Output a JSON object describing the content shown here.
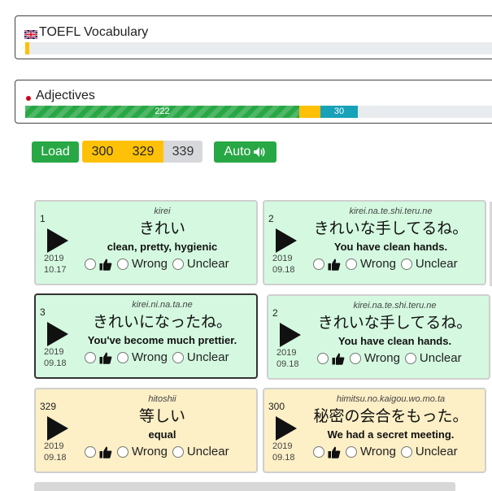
{
  "decks": [
    {
      "title": "TOEFL Vocabulary",
      "flag": "uk-flag",
      "progress": {
        "known_fraction": 0.01
      }
    },
    {
      "title": "Adjectives",
      "flag": "japan-flag",
      "progress": {
        "known": "222",
        "learning": "",
        "review": "30"
      }
    }
  ],
  "toolbar": {
    "load_label": "Load",
    "range_from": "300",
    "range_to": "329",
    "range_total": "339",
    "auto_label": "Auto"
  },
  "options": {
    "wrong": "Wrong",
    "unclear": "Unclear"
  },
  "cards": [
    {
      "num": "1",
      "romaji": "kirei",
      "jp": "きれい",
      "en": "clean, pretty, hygienic",
      "year": "2019",
      "date": "10.17"
    },
    {
      "num": "2",
      "romaji": "kirei.na.te.shi.teru.ne",
      "jp": "きれいな手してるね。",
      "en": "You have clean hands.",
      "year": "2019",
      "date": "09.18"
    },
    {
      "num": "3",
      "romaji": "kirei.ni.na.ta.ne",
      "jp": "きれいになったね。",
      "en": "You've become much prettier.",
      "year": "2019",
      "date": "09.18"
    },
    {
      "num": "2",
      "romaji": "kirei.na.te.shi.teru.ne",
      "jp": "きれいな手してるね。",
      "en": "You have clean hands.",
      "year": "2019",
      "date": "09.18"
    },
    {
      "num": "329",
      "romaji": "hitoshii",
      "jp": "等しい",
      "en": "equal",
      "year": "2019",
      "date": "09.18"
    },
    {
      "num": "300",
      "romaji": "himitsu.no.kaigou.wo.mo.ta",
      "jp": "秘密の会合をもった。",
      "en": "We had a secret meeting.",
      "year": "2019",
      "date": "09.18"
    }
  ],
  "colors": {
    "green": "#28a745",
    "amber": "#ffc107",
    "teal": "#17a2b8",
    "card_green": "#d4f9e0",
    "card_cream": "#fdefc6"
  }
}
